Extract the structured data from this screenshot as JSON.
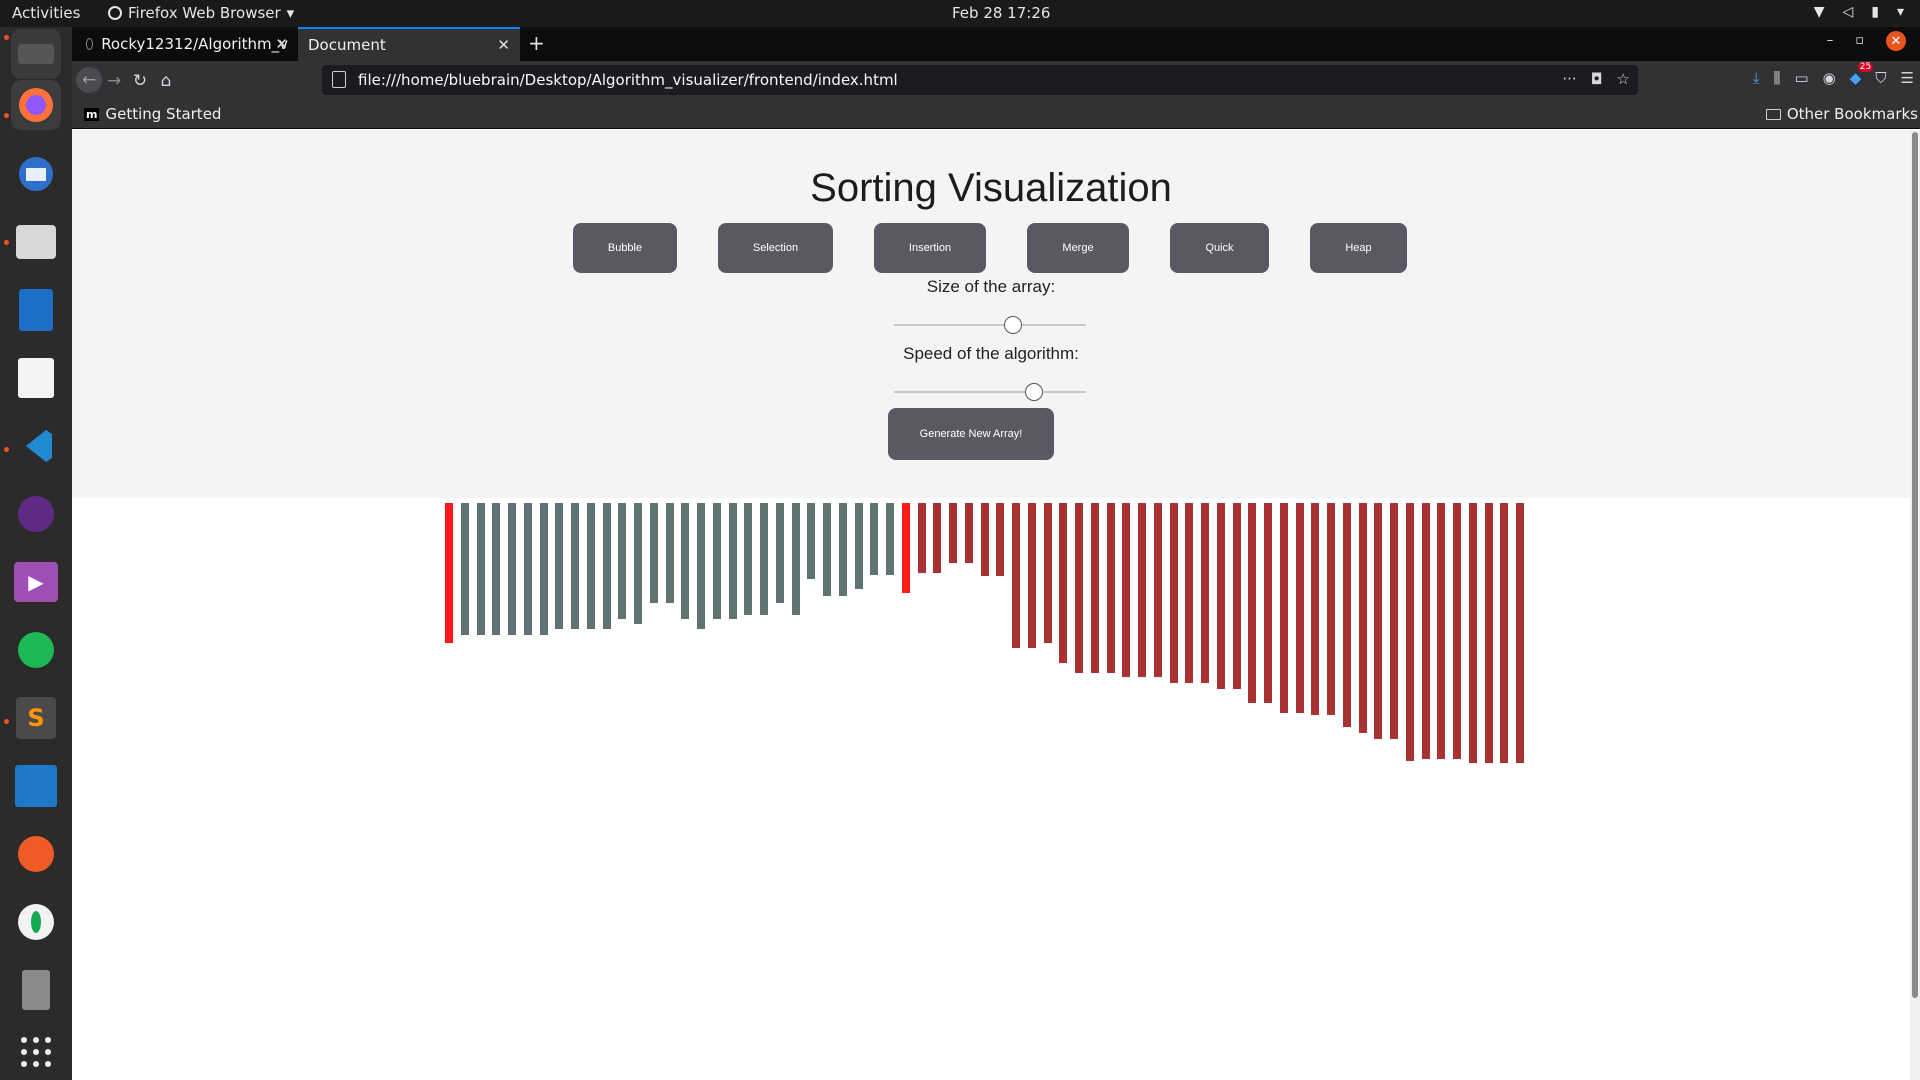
{
  "topbar": {
    "activities": "Activities",
    "app_name": "Firefox Web Browser",
    "clock": "Feb 28  17:26"
  },
  "browser": {
    "tabs": [
      {
        "label": "Rocky12312/Algorithm_v"
      },
      {
        "label": "Document"
      }
    ],
    "url": "file:///home/bluebrain/Desktop/Algorithm_visualizer/frontend/index.html",
    "bookmark_getting_started": "Getting Started",
    "bookmark_other": "Other Bookmarks",
    "notification_count": "25"
  },
  "page": {
    "title": "Sorting Visualization",
    "buttons": [
      "Bubble",
      "Selection",
      "Insertion",
      "Merge",
      "Quick",
      "Heap"
    ],
    "size_label": "Size of the array:",
    "speed_label": "Speed of the algorithm:",
    "size_value": 0.62,
    "speed_value": 0.73,
    "generate_label": "Generate New Array!"
  },
  "colors": {
    "bar_default": "#5f7373",
    "bar_sorted": "#a83232",
    "bar_active": "#ff1a1a",
    "button_bg": "#5a5862"
  },
  "bar_heights": [
    140,
    132,
    132,
    132,
    132,
    132,
    132,
    126,
    126,
    126,
    126,
    116,
    121,
    100,
    100,
    116,
    126,
    116,
    116,
    112,
    112,
    100,
    112,
    76,
    93,
    93,
    86,
    72,
    72,
    90,
    70,
    70,
    60,
    60,
    73,
    73,
    145,
    145,
    140,
    160,
    170,
    170,
    170,
    174,
    174,
    174,
    180,
    180,
    180,
    186,
    186,
    200,
    200,
    210,
    210,
    212,
    212,
    224,
    230,
    236,
    236,
    258,
    256,
    256,
    256,
    260,
    260,
    260,
    260
  ],
  "bar_states": [
    "active",
    "default",
    "default",
    "default",
    "default",
    "default",
    "default",
    "default",
    "default",
    "default",
    "default",
    "default",
    "default",
    "default",
    "default",
    "default",
    "default",
    "default",
    "default",
    "default",
    "default",
    "default",
    "default",
    "default",
    "default",
    "default",
    "default",
    "default",
    "default",
    "active",
    "sorted",
    "sorted",
    "sorted",
    "sorted",
    "sorted",
    "sorted",
    "sorted",
    "sorted",
    "sorted",
    "sorted",
    "sorted",
    "sorted",
    "sorted",
    "sorted",
    "sorted",
    "sorted",
    "sorted",
    "sorted",
    "sorted",
    "sorted",
    "sorted",
    "sorted",
    "sorted",
    "sorted",
    "sorted",
    "sorted",
    "sorted",
    "sorted",
    "sorted",
    "sorted",
    "sorted",
    "sorted",
    "sorted",
    "sorted",
    "sorted",
    "sorted",
    "sorted",
    "sorted",
    "sorted"
  ]
}
